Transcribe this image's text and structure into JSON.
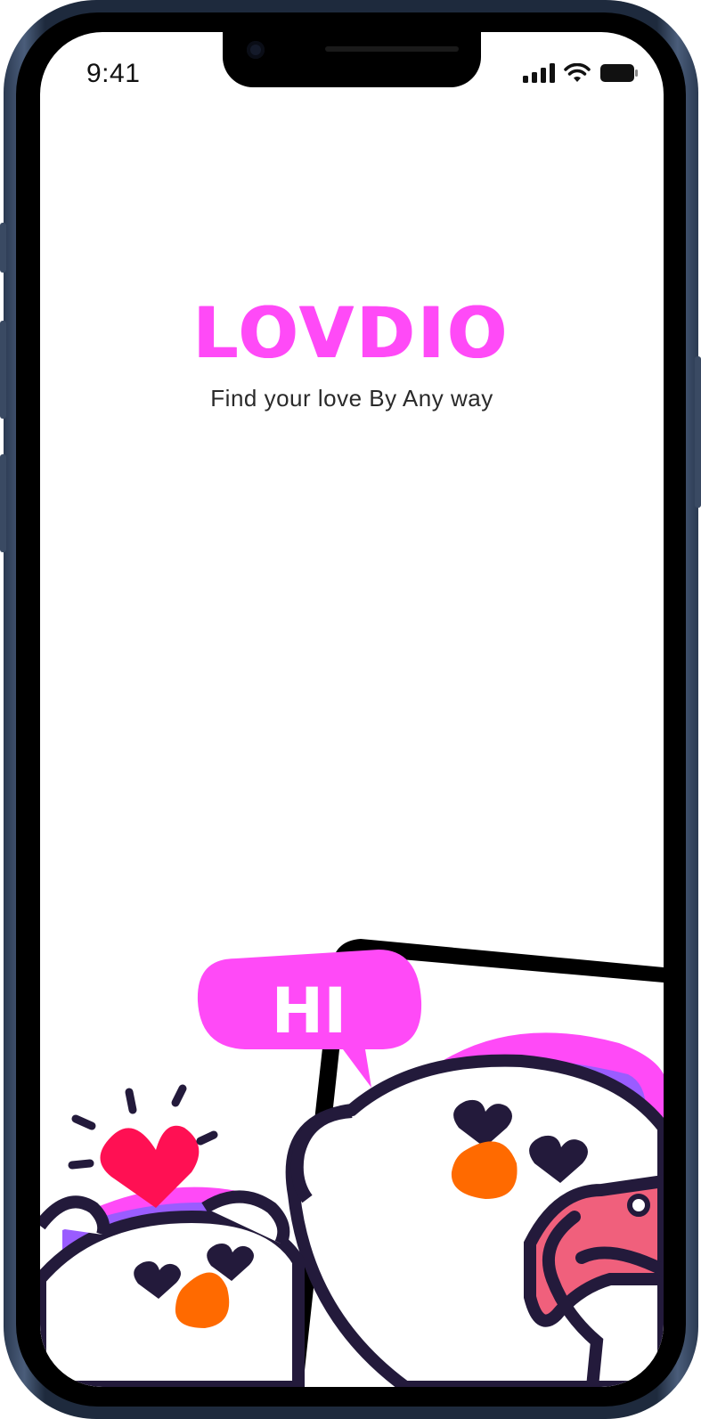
{
  "status_bar": {
    "time": "9:41",
    "icons": [
      "cellular-signal-icon",
      "wifi-icon",
      "battery-icon"
    ]
  },
  "brand": {
    "name": "LOVDIO",
    "tagline": "Find your love By Any way"
  },
  "illustration": {
    "speech_bubble": "HI",
    "colors": {
      "pink": "#ff4af7",
      "purple": "#9a5cff",
      "dark": "#231a3b",
      "orange": "#ff6a00",
      "red_heart": "#ff1053",
      "phone_pink": "#f0607c"
    }
  }
}
